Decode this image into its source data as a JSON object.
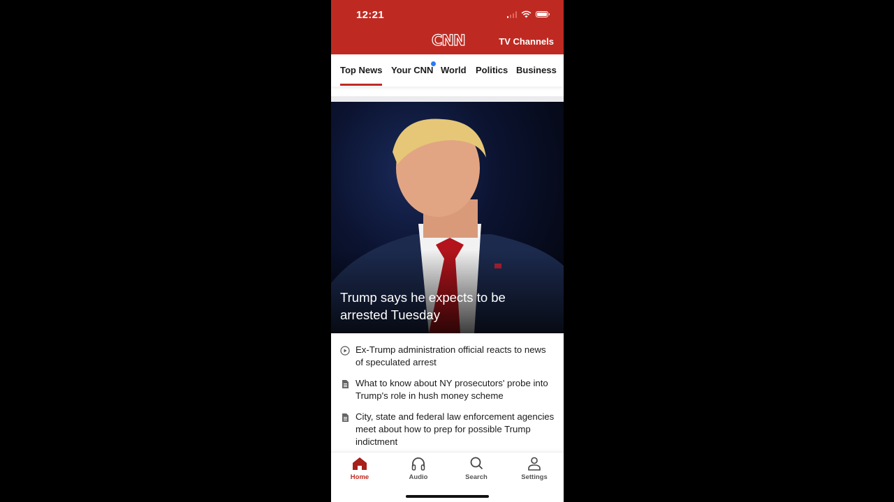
{
  "status_bar": {
    "time": "12:21"
  },
  "header": {
    "logo": "CNN",
    "tv_channels_label": "TV Channels",
    "brand_color": "#be2a22"
  },
  "tabs": [
    {
      "label": "Top News",
      "active": true
    },
    {
      "label": "Your CNN",
      "has_notification_dot": true
    },
    {
      "label": "World"
    },
    {
      "label": "Politics"
    },
    {
      "label": "Business"
    }
  ],
  "hero": {
    "title": "Trump says he expects to be arrested Tuesday"
  },
  "related": [
    {
      "icon": "play-circle-icon",
      "text": "Ex-Trump administration official reacts to news of speculated arrest"
    },
    {
      "icon": "document-icon",
      "text": "What to know about NY prosecutors' probe into Trump's role in hush money scheme"
    },
    {
      "icon": "document-icon",
      "text": "City, state and federal law enforcement agencies meet about how to prep for possible Trump indictment"
    }
  ],
  "bottom_nav": [
    {
      "label": "Home",
      "icon": "home-icon",
      "active": true
    },
    {
      "label": "Audio",
      "icon": "headphones-icon"
    },
    {
      "label": "Search",
      "icon": "search-icon"
    },
    {
      "label": "Settings",
      "icon": "person-icon"
    }
  ]
}
